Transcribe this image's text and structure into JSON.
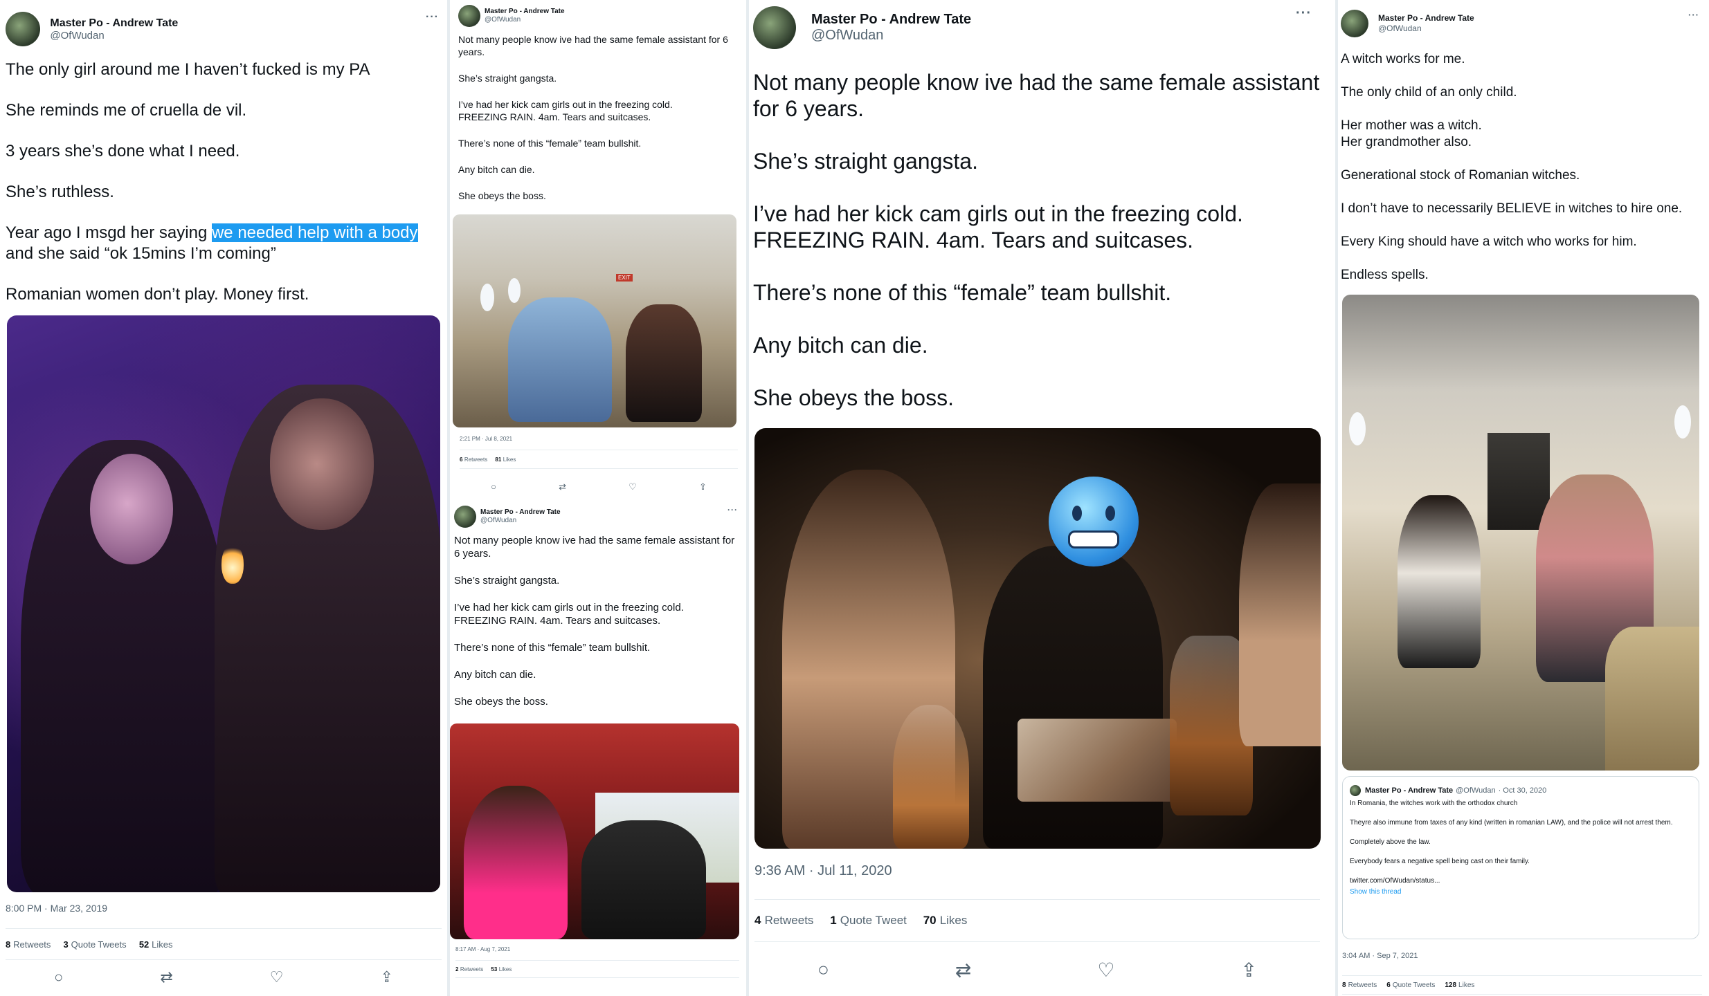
{
  "author": {
    "name": "Master Po - Andrew Tate",
    "handle": "@OfWudan",
    "more": "···"
  },
  "actions": {
    "reply": "○",
    "retweet": "⇄",
    "like": "♡",
    "share": "⇪"
  },
  "col1": {
    "p1": "The only girl around me I haven’t fucked is my PA",
    "p2": "She reminds me of cruella de vil.",
    "p3": "3 years she’s done what I need.",
    "p4": "She’s ruthless.",
    "p5_pre": "Year ago I msgd her saying ",
    "p5_highlight": "we needed help with a body",
    "p5_post": "and she said “ok 15mins I’m coming”",
    "p6": "Romanian women don’t play. Money first.",
    "timestamp": "8:00 PM · Mar 23, 2019",
    "stats": {
      "retweets_n": "8",
      "retweets_l": "Retweets",
      "quotes_n": "3",
      "quotes_l": "Quote Tweets",
      "likes_n": "52",
      "likes_l": "Likes"
    }
  },
  "assistant_text": {
    "p1": "Not many people know ive had the same female assistant for 6 years.",
    "p2": "She’s straight gangsta.",
    "p3": "I’ve had her kick cam girls out in the freezing cold.\nFREEZING RAIN. 4am. Tears and suitcases.",
    "p4": "There’s none of this “female” team bullshit.",
    "p5": "Any bitch can die.",
    "p6": "She obeys the boss."
  },
  "col2a": {
    "timestamp": "2:21 PM · Jul 8, 2021",
    "retweets_n": "6",
    "retweets_l": "Retweets",
    "likes_n": "81",
    "likes_l": "Likes"
  },
  "col2b": {
    "timestamp": "8:17 AM · Aug 7, 2021",
    "retweets_n": "2",
    "retweets_l": "Retweets",
    "likes_n": "53",
    "likes_l": "Likes"
  },
  "col3": {
    "timestamp": "9:36 AM · Jul 11, 2020",
    "retweets_n": "4",
    "retweets_l": "Retweets",
    "quotes_n": "1",
    "quotes_l": "Quote Tweet",
    "likes_n": "70",
    "likes_l": "Likes",
    "exit_sign": "EXIT"
  },
  "col4": {
    "p1": "A witch works for me.",
    "p2": "The only child of an only child.",
    "p3": "Her mother was a witch.\nHer grandmother also.",
    "p4": "Generational stock of Romanian witches.",
    "p5": "I don’t have to necessarily BELIEVE in witches to hire one.",
    "p6": "Every King should have a witch who works for him.",
    "p7": "Endless spells.",
    "quote": {
      "date": "· Oct 30, 2020",
      "q1": "In Romania, the witches work with the orthodox church",
      "q2": "Theyre also immune from taxes of any kind (written in romanian LAW), and the police will not arrest them.",
      "q3": "Completely above the law.",
      "q4": "Everybody fears a negative spell being cast on their family.",
      "q5": "twitter.com/OfWudan/status...",
      "show": "Show this thread"
    },
    "timestamp": "3:04 AM · Sep 7, 2021",
    "retweets_n": "8",
    "retweets_l": "Retweets",
    "quotes_n": "6",
    "quotes_l": "Quote Tweets",
    "likes_n": "128",
    "likes_l": "Likes"
  }
}
